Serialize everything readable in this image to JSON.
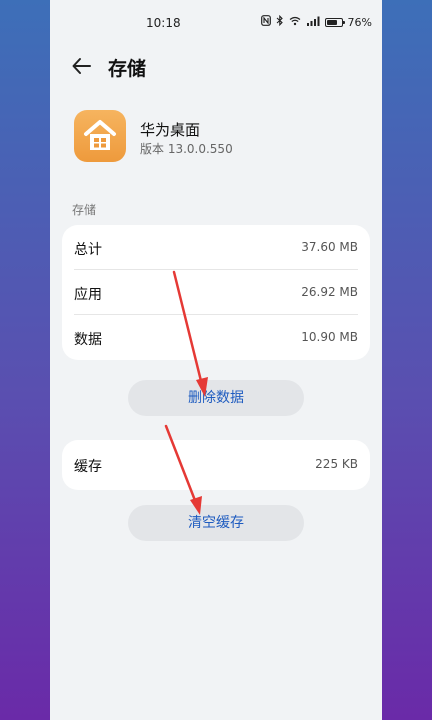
{
  "status_bar": {
    "time": "10:18",
    "battery": "76%",
    "battery_level": 0.76
  },
  "header": {
    "title": "存储"
  },
  "app": {
    "name": "华为桌面",
    "version": "版本 13.0.0.550"
  },
  "storage_section": {
    "label": "存储",
    "rows": [
      {
        "label": "总计",
        "value": "37.60 MB"
      },
      {
        "label": "应用",
        "value": "26.92 MB"
      },
      {
        "label": "数据",
        "value": "10.90 MB"
      }
    ],
    "button_label": "删除数据"
  },
  "cache_section": {
    "rows": [
      {
        "label": "缓存",
        "value": "225 KB"
      }
    ],
    "button_label": "清空缓存"
  },
  "colors": {
    "accent": "#1f5cc0",
    "annotation_arrow": "#e53935",
    "app_icon": "#f0a347"
  },
  "icons": [
    "back-arrow-icon",
    "nfc-icon",
    "bluetooth-icon",
    "wifi-icon",
    "signal-icon",
    "battery-icon",
    "house-icon"
  ]
}
